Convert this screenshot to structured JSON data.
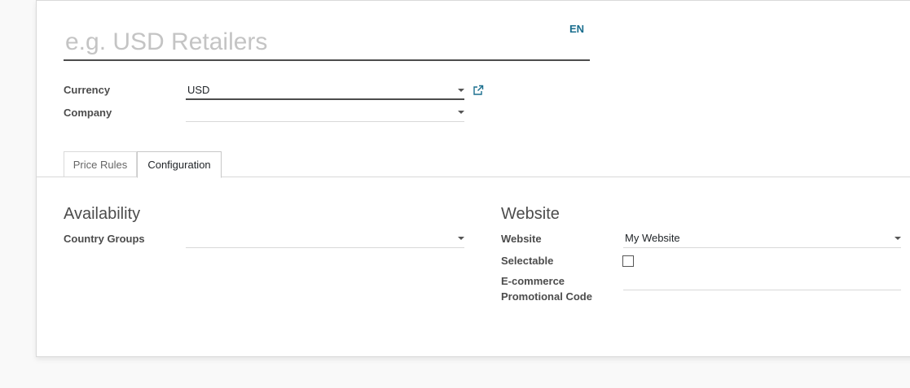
{
  "form": {
    "name_placeholder": "e.g. USD Retailers",
    "language": "EN",
    "currency_label": "Currency",
    "currency_value": "USD",
    "company_label": "Company",
    "company_value": ""
  },
  "tabs": [
    {
      "label": "Price Rules",
      "active": false
    },
    {
      "label": "Configuration",
      "active": true
    }
  ],
  "availability": {
    "title": "Availability",
    "country_groups_label": "Country Groups",
    "country_groups_value": ""
  },
  "website": {
    "title": "Website",
    "website_label": "Website",
    "website_value": "My Website",
    "selectable_label": "Selectable",
    "selectable_checked": false,
    "promo_label_line1": "E-commerce",
    "promo_label_line2": "Promotional Code",
    "promo_value": ""
  },
  "icons": {
    "external_link": "external-link-icon",
    "dropdown": "caret-down-icon"
  },
  "colors": {
    "link": "#1a6e8e",
    "text": "#4c4c4c",
    "background": "#f9f9f9"
  }
}
